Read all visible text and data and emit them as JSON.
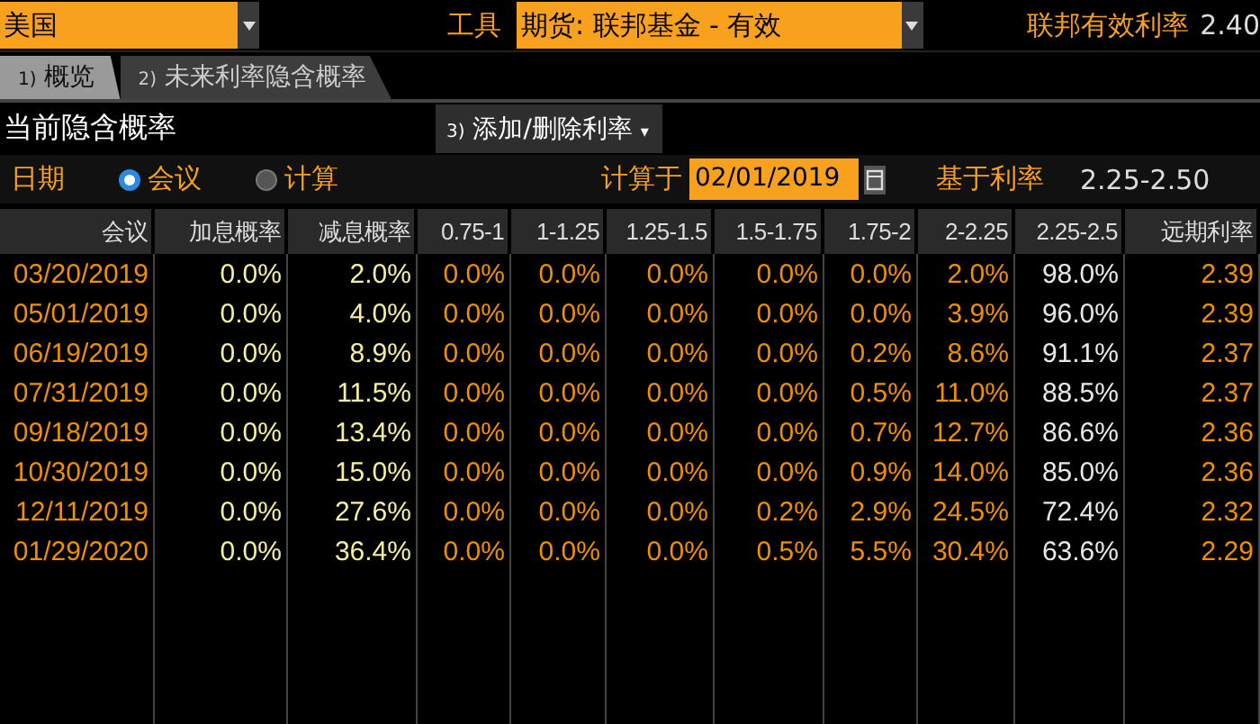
{
  "toolbar": {
    "country": "美国",
    "instrument_label": "工具",
    "instrument": "期货: 联邦基金 - 有效",
    "rate_label": "联邦有效利率",
    "rate": "2.40"
  },
  "tabs": [
    {
      "number": "1)",
      "label": "概览",
      "selected": true
    },
    {
      "number": "2)",
      "label": "未来利率隐含概率",
      "selected": false
    }
  ],
  "section": {
    "title": "当前隐含概率",
    "action": {
      "number": "3)",
      "label": "添加/删除利率",
      "caret": "▾"
    }
  },
  "options": {
    "date_label": "日期",
    "modes": [
      {
        "label": "会议",
        "selected": true
      },
      {
        "label": "计算",
        "selected": false
      }
    ],
    "calc_label": "计算于",
    "calc_date": "02/01/2019",
    "base_label": "基于利率",
    "base_rate": "2.25-2.50"
  },
  "table": {
    "columns": [
      {
        "label": "会议",
        "kind": "date"
      },
      {
        "label": "加息概率",
        "kind": "change"
      },
      {
        "label": "减息概率",
        "kind": "change"
      },
      {
        "label": "0.75-1",
        "kind": "bucket"
      },
      {
        "label": "1-1.25",
        "kind": "bucket"
      },
      {
        "label": "1.25-1.5",
        "kind": "bucket"
      },
      {
        "label": "1.5-1.75",
        "kind": "bucket"
      },
      {
        "label": "1.75-2",
        "kind": "bucket"
      },
      {
        "label": "2-2.25",
        "kind": "bucket"
      },
      {
        "label": "2.25-2.5",
        "kind": "base"
      },
      {
        "label": "远期利率",
        "kind": "forward"
      }
    ],
    "rows": [
      [
        "03/20/2019",
        "0.0%",
        "2.0%",
        "0.0%",
        "0.0%",
        "0.0%",
        "0.0%",
        "0.0%",
        "2.0%",
        "98.0%",
        "2.39"
      ],
      [
        "05/01/2019",
        "0.0%",
        "4.0%",
        "0.0%",
        "0.0%",
        "0.0%",
        "0.0%",
        "0.0%",
        "3.9%",
        "96.0%",
        "2.39"
      ],
      [
        "06/19/2019",
        "0.0%",
        "8.9%",
        "0.0%",
        "0.0%",
        "0.0%",
        "0.0%",
        "0.2%",
        "8.6%",
        "91.1%",
        "2.37"
      ],
      [
        "07/31/2019",
        "0.0%",
        "11.5%",
        "0.0%",
        "0.0%",
        "0.0%",
        "0.0%",
        "0.5%",
        "11.0%",
        "88.5%",
        "2.37"
      ],
      [
        "09/18/2019",
        "0.0%",
        "13.4%",
        "0.0%",
        "0.0%",
        "0.0%",
        "0.0%",
        "0.7%",
        "12.7%",
        "86.6%",
        "2.36"
      ],
      [
        "10/30/2019",
        "0.0%",
        "15.0%",
        "0.0%",
        "0.0%",
        "0.0%",
        "0.0%",
        "0.9%",
        "14.0%",
        "85.0%",
        "2.36"
      ],
      [
        "12/11/2019",
        "0.0%",
        "27.6%",
        "0.0%",
        "0.0%",
        "0.0%",
        "0.2%",
        "2.9%",
        "24.5%",
        "72.4%",
        "2.32"
      ],
      [
        "01/29/2020",
        "0.0%",
        "36.4%",
        "0.0%",
        "0.0%",
        "0.0%",
        "0.5%",
        "5.5%",
        "30.4%",
        "63.6%",
        "2.29"
      ]
    ]
  }
}
